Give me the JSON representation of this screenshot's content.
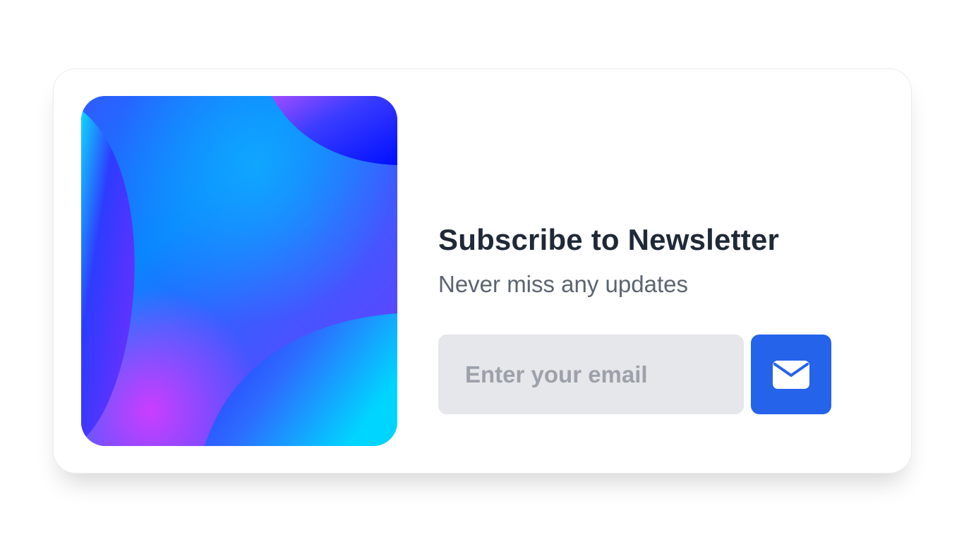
{
  "newsletter": {
    "title": "Subscribe to Newsletter",
    "subtitle": "Never miss any updates",
    "email_placeholder": "Enter your email",
    "email_value": "",
    "submit_icon": "envelope-icon"
  },
  "colors": {
    "accent": "#2563eb",
    "input_bg": "#e6e7ea",
    "title": "#1f2937",
    "subtitle": "#5b6472",
    "placeholder": "#9ca1ab"
  }
}
